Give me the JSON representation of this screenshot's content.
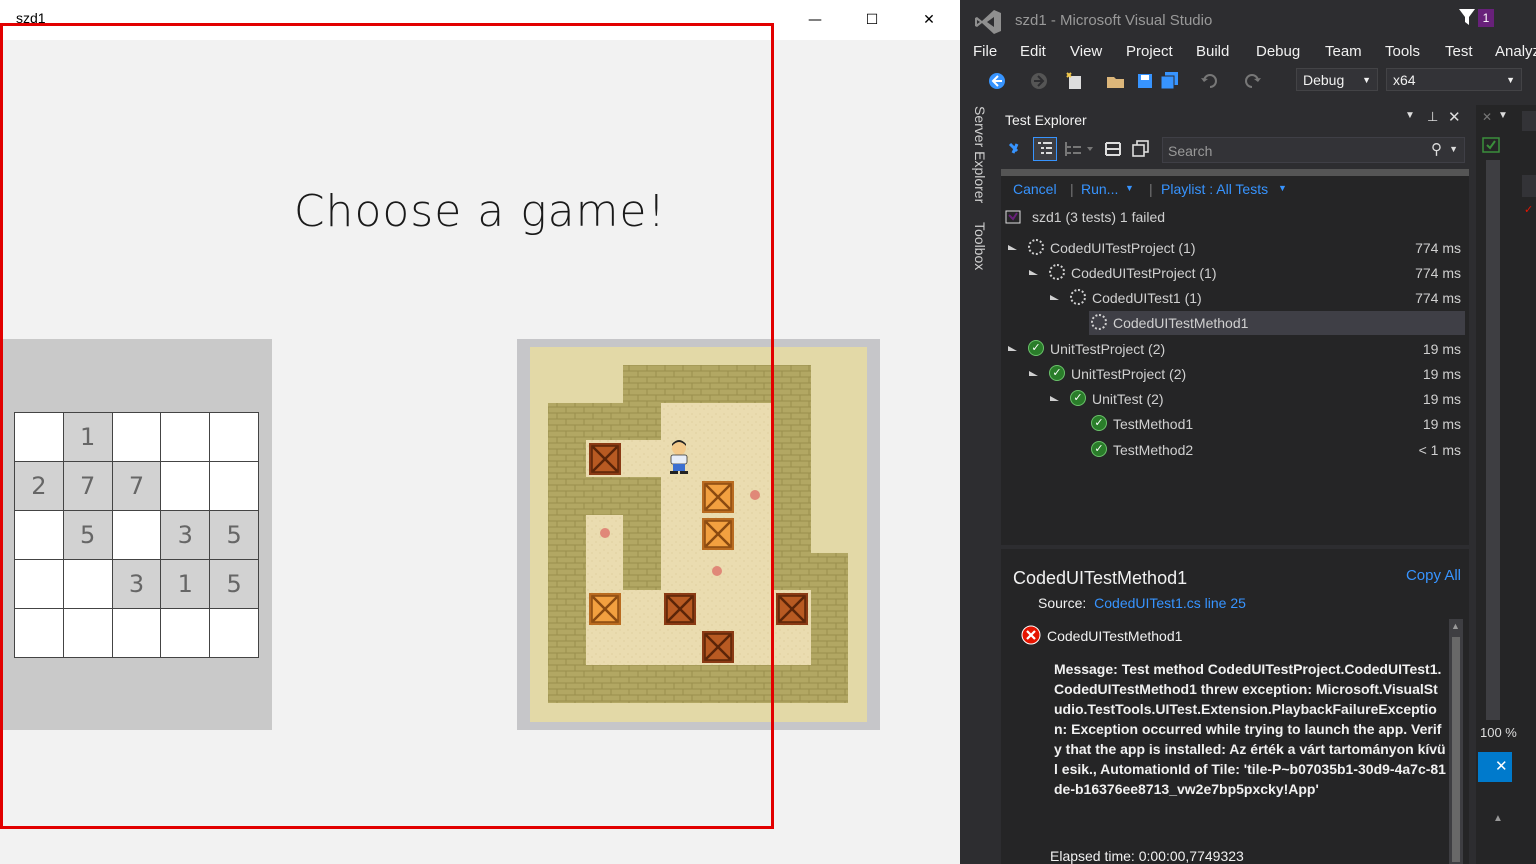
{
  "app": {
    "title": "szd1",
    "heading": "Choose a game!",
    "grid_rows": [
      [
        "",
        "1",
        "",
        "",
        ""
      ],
      [
        "2",
        "7",
        "7",
        "",
        ""
      ],
      [
        "",
        "5",
        "",
        "3",
        "5"
      ],
      [
        "",
        "",
        "3",
        "1",
        "5"
      ],
      [
        "",
        "",
        "",
        "",
        ""
      ]
    ],
    "window_buttons": {
      "minimize": "—",
      "maximize": "☐",
      "close": "✕"
    }
  },
  "vs": {
    "title": "szd1 - Microsoft Visual Studio",
    "notification_count": "1",
    "menu": [
      "File",
      "Edit",
      "View",
      "Project",
      "Build",
      "Debug",
      "Team",
      "Tools",
      "Test",
      "Analyz"
    ],
    "config": "Debug",
    "platform": "x64",
    "side_tabs": [
      "Server Explorer",
      "Toolbox"
    ],
    "test_explorer": {
      "title": "Test Explorer",
      "search_placeholder": "Search",
      "links": {
        "cancel": "Cancel",
        "run": "Run...",
        "playlist": "Playlist : All Tests"
      },
      "summary": "szd1 (3 tests) 1 failed",
      "tree": [
        {
          "label": "CodedUITestProject (1)",
          "duration": "774 ms",
          "status": "running"
        },
        {
          "label": "CodedUITestProject (1)",
          "duration": "774 ms",
          "status": "running"
        },
        {
          "label": "CodedUITest1 (1)",
          "duration": "774 ms",
          "status": "running"
        },
        {
          "label": "CodedUITestMethod1",
          "duration": "",
          "status": "running"
        },
        {
          "label": "UnitTestProject (2)",
          "duration": "19 ms",
          "status": "passed"
        },
        {
          "label": "UnitTestProject (2)",
          "duration": "19 ms",
          "status": "passed"
        },
        {
          "label": "UnitTest (2)",
          "duration": "19 ms",
          "status": "passed"
        },
        {
          "label": "TestMethod1",
          "duration": "19 ms",
          "status": "passed"
        },
        {
          "label": "TestMethod2",
          "duration": "< 1 ms",
          "status": "passed"
        }
      ],
      "detail": {
        "name": "CodedUITestMethod1",
        "copy_all": "Copy All",
        "source_label": "Source:",
        "source_link": "CodedUITest1.cs line 25",
        "error_name": "CodedUITestMethod1",
        "message": "Message: Test method CodedUITestProject.CodedUITest1.CodedUITestMethod1 threw exception: Microsoft.VisualStudio.TestTools.UITest.Extension.PlaybackFailureException: Exception occurred while trying to launch the app. Verify that the app is installed: Az érték a várt tartományon kívül esik., AutomationId of Tile: 'tile-P~b07035b1-30d9-4a7c-81de-b16376ee8713_vw2e7bp5pxcky!App'",
        "elapsed": "Elapsed time: 0:00:00,7749323"
      }
    },
    "zoom_fragment": "100 %"
  }
}
